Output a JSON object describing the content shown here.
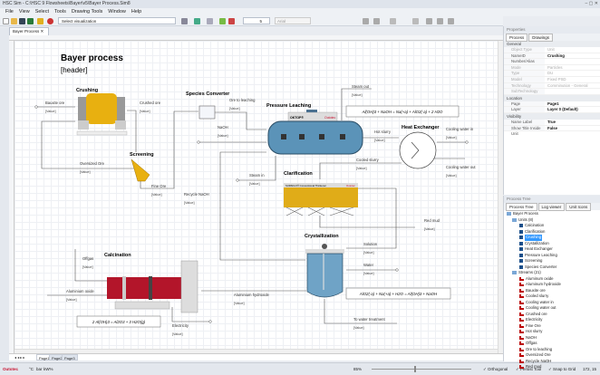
{
  "window": {
    "title": "HSC Sim - C:\\HSC 9 Flowsheets\\Bayer\\v5\\Bayer Process.Sim8",
    "controls": "–  ▢  ✕"
  },
  "menu": [
    "File",
    "View",
    "Select",
    "Tools",
    "Drawing Tools",
    "Window",
    "Help"
  ],
  "toolbar": {
    "visualization_select": "Select visualization",
    "font_size": "5",
    "font_name": "Arial"
  },
  "document_tab": {
    "label": "Bayer Process",
    "close": "✕"
  },
  "page_tabs": [
    "Page1",
    "Page2",
    "Page3"
  ],
  "statusbar": {
    "brand": "Outotec",
    "units": [
      "°C",
      "bar",
      "kW%"
    ],
    "zoom": "85%",
    "toggles": [
      "Orthogonal",
      "Persist Tool",
      "Snap to Grid"
    ],
    "coords": "172, 15"
  },
  "colors": {
    "accent": "#3399ff",
    "brand": "#c8102e",
    "equipment_yellow": "#e8b010",
    "vessel_blue": "#5b93b8",
    "kiln_red": "#b3152a"
  },
  "diagram": {
    "title": "Bayer process",
    "header": "[header]",
    "units": [
      "Crushing",
      "Screening",
      "Species Converter",
      "Pressure Leaching",
      "Heat Exchanger",
      "Clarification",
      "Crystallization",
      "Calcination"
    ],
    "equipment_labels": {
      "leach": "OKTOP®",
      "leach_brand": "Outotec",
      "clar": "SUPAFLO® Conventional Thickener",
      "clar_brand": "Outotec"
    },
    "reactions": [
      "Al(OH)3 + NaOH = Na(+a) + AlO2(-a) + 2 H2O",
      "AlO2(-a) + Na(+a) + H2O = Al(OH)3 + NaOH",
      "2 Al(OH)3 = Al2O3 + 3 H2O(g)"
    ],
    "value_placeholder": "[Value]",
    "streams": [
      "Bauxite ore",
      "Crushed ore",
      "Oversized Ore",
      "Fine Ore",
      "Ore to leaching",
      "NaOH",
      "Recycle NaOH",
      "Steam out",
      "Hot slurry",
      "Cooling water in",
      "Cooling water out",
      "Cooled slurry",
      "Steam in",
      "Red mud",
      "Solution",
      "Water",
      "To water treatment",
      "Aluminium hydroxide",
      "Offgas",
      "Aluminium oxide",
      "Electricity"
    ]
  },
  "properties": {
    "title": "Properties",
    "tabs": [
      "Process",
      "Drawings"
    ],
    "groups": [
      {
        "name": "General",
        "rows": [
          [
            "Object Type",
            "Unit",
            1
          ],
          [
            "NameID",
            "Crushing",
            0
          ],
          [
            "Number/Alias",
            "",
            0
          ],
          [
            "Mode",
            "Particles",
            1
          ],
          [
            "Type",
            "DU",
            1
          ],
          [
            "Model",
            "Fixed PSD",
            1
          ],
          [
            "Technology",
            "Comminution - General",
            1
          ],
          [
            "SubTechnology",
            "",
            1
          ]
        ]
      },
      {
        "name": "Location",
        "rows": [
          [
            "Page",
            "Page1",
            0
          ],
          [
            "Layer",
            "Layer 0 (Default)",
            0
          ]
        ]
      },
      {
        "name": "Visibility",
        "rows": [
          [
            "Name Label",
            "True",
            0
          ],
          [
            "Show Title Inside Unit",
            "False",
            0
          ]
        ]
      }
    ]
  },
  "process_tree": {
    "title": "Process Tree",
    "tabs": [
      "Process Tree",
      "Log viewer",
      "Unit Icons"
    ],
    "root": "Bayer Process",
    "units_label": "Units (8)",
    "selected": "Crushing",
    "units": [
      "Calcination",
      "Clarification",
      "Crushing",
      "Crystallization",
      "Heat Exchanger",
      "Pressure Leaching",
      "Screening",
      "Species Converter"
    ],
    "streams_label": "Streams (21)",
    "streams": [
      "Aluminum oxide",
      "Aluminum hydroxide",
      "Bauxite ore",
      "Cooled slurry",
      "Cooling water in",
      "Cooling water out",
      "Crushed ore",
      "Electricity",
      "Fine Ore",
      "Hot slurry",
      "NaOH",
      "Offgas",
      "Ore to leaching",
      "Oversized Ore",
      "Recycle NaOH",
      "Red mud"
    ]
  }
}
